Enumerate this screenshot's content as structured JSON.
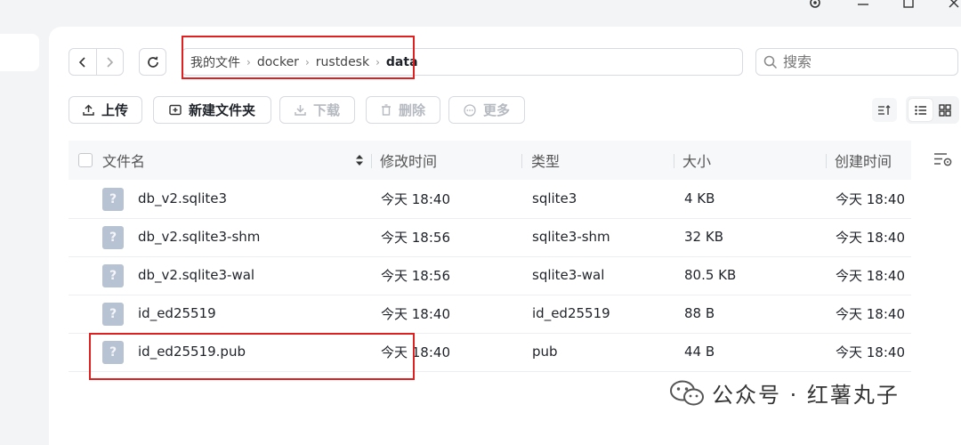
{
  "breadcrumb": [
    "我的文件",
    "docker",
    "rustdesk",
    "data"
  ],
  "search": {
    "placeholder": "搜索"
  },
  "toolbar": {
    "upload": "上传",
    "new_folder": "新建文件夹",
    "download": "下载",
    "delete": "删除",
    "more": "更多"
  },
  "columns": {
    "name": "文件名",
    "modified": "修改时间",
    "type": "类型",
    "size": "大小",
    "created": "创建时间"
  },
  "files": [
    {
      "name": "db_v2.sqlite3",
      "modified": "今天 18:40",
      "type": "sqlite3",
      "size": "4 KB",
      "created": "今天 18:40"
    },
    {
      "name": "db_v2.sqlite3-shm",
      "modified": "今天 18:56",
      "type": "sqlite3-shm",
      "size": "32 KB",
      "created": "今天 18:40"
    },
    {
      "name": "db_v2.sqlite3-wal",
      "modified": "今天 18:56",
      "type": "sqlite3-wal",
      "size": "80.5 KB",
      "created": "今天 18:40"
    },
    {
      "name": "id_ed25519",
      "modified": "今天 18:40",
      "type": "id_ed25519",
      "size": "88 B",
      "created": "今天 18:40"
    },
    {
      "name": "id_ed25519.pub",
      "modified": "今天 18:40",
      "type": "pub",
      "size": "44 B",
      "created": "今天 18:40"
    }
  ],
  "file_icon_glyph": "?",
  "watermark": {
    "text": "公众号 · 红薯丸子"
  },
  "colors": {
    "highlight": "#e02020",
    "file_icon": "#b7c3d3",
    "border": "#d7dae0"
  }
}
